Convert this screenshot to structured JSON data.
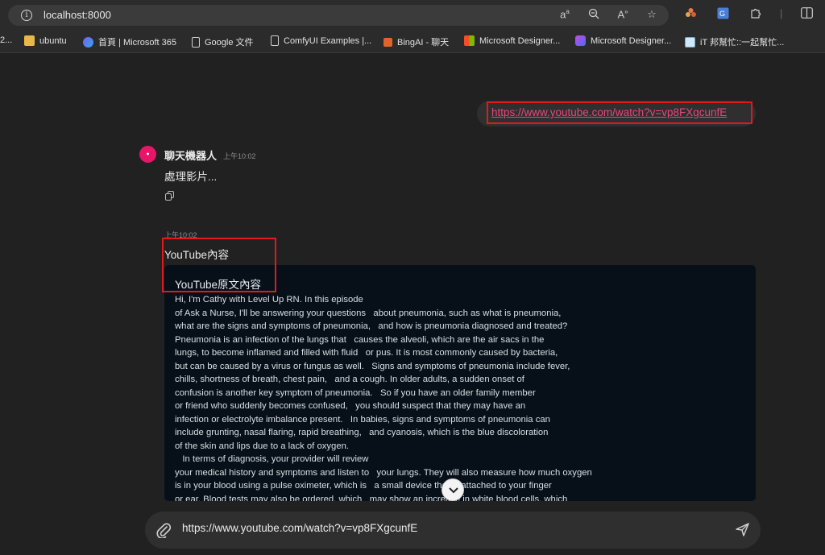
{
  "browser": {
    "url": "localhost:8000",
    "bookmarks": [
      {
        "label": "2..."
      },
      {
        "label": "ubuntu"
      },
      {
        "label": "首頁 | Microsoft 365"
      },
      {
        "label": "Google 文件"
      },
      {
        "label": "ComfyUI Examples |..."
      },
      {
        "label": "BingAI - 聊天"
      },
      {
        "label": "Microsoft Designer..."
      },
      {
        "label": "Microsoft Designer..."
      },
      {
        "label": "iT 邦幫忙::一起幫忙..."
      }
    ]
  },
  "chat": {
    "user_message": "https://www.youtube.com/watch?v=vp8FXgcunfE",
    "bot": {
      "name": "聊天機器人",
      "time": "上午10:02",
      "message": "處理影片...",
      "second_time": "上午10:02",
      "second_title": "YouTube內容",
      "code_heading": "YouTube原文內容",
      "transcript": "Hi, I'm Cathy with Level Up RN. In this episode\nof Ask a Nurse, I'll be answering your questions   about pneumonia, such as what is pneumonia,\nwhat are the signs and symptoms of pneumonia,   and how is pneumonia diagnosed and treated?\nPneumonia is an infection of the lungs that   causes the alveoli, which are the air sacs in the\nlungs, to become inflamed and filled with fluid   or pus. It is most commonly caused by bacteria,\nbut can be caused by a virus or fungus as well.   Signs and symptoms of pneumonia include fever,\nchills, shortness of breath, chest pain,   and a cough. In older adults, a sudden onset of\nconfusion is another key symptom of pneumonia.   So if you have an older family member\nor friend who suddenly becomes confused,   you should suspect that they may have an\ninfection or electrolyte imbalance present.   In babies, signs and symptoms of pneumonia can\ninclude grunting, nasal flaring, rapid breathing,   and cyanosis, which is the blue discoloration\nof the skin and lips due to a lack of oxygen.\n   In terms of diagnosis, your provider will review\nyour medical history and symptoms and listen to   your lungs. They will also measure how much oxygen\nis in your blood using a pulse oximeter, which is   a small device that is attached to your finger\nor ear. Blood tests may also be ordered, which   may show an increase in white blood cells, which"
    },
    "composer_value": "https://www.youtube.com/watch?v=vp8FXgcunfE"
  },
  "colors": {
    "highlight_box": "#e01b1b",
    "link": "#e8467c",
    "avatar": "#e8156b"
  }
}
